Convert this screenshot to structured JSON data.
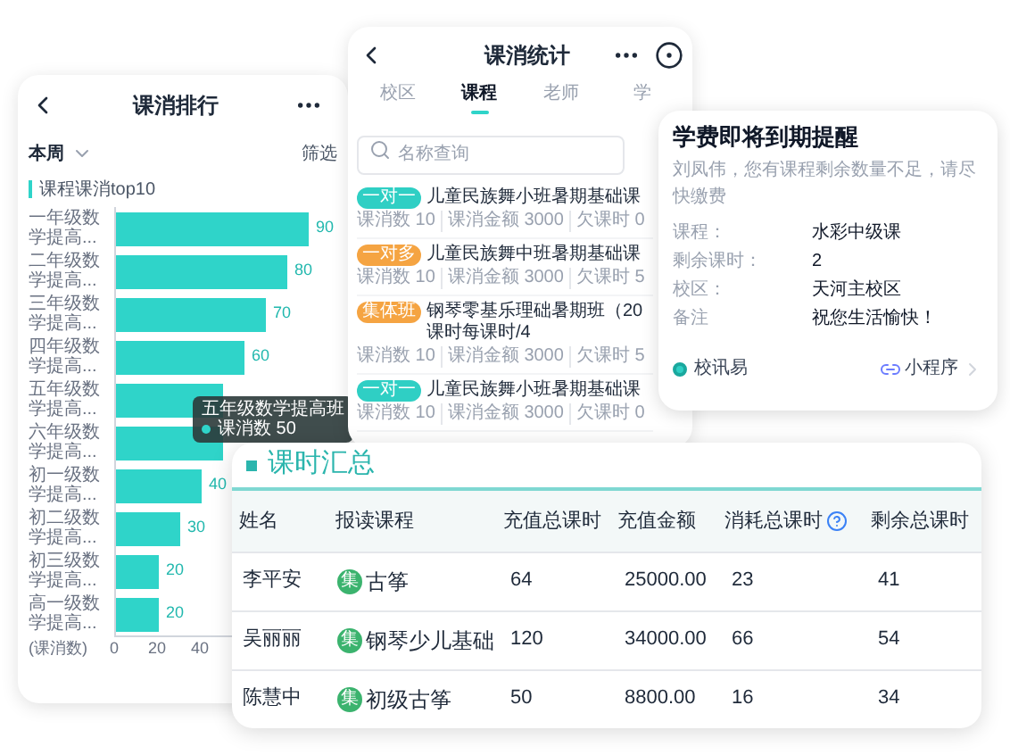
{
  "ranking_card": {
    "title": "课消排行",
    "period": "本周",
    "filter": "筛选",
    "section_title": "课程课消top10",
    "chart_data": {
      "type": "bar",
      "orientation": "horizontal",
      "xlabel": "(课消数)",
      "categories": [
        "一年级数学提高...",
        "二年级数学提高...",
        "三年级数学提高...",
        "四年级数学提高...",
        "五年级数学提高...",
        "六年级数学提高...",
        "初一级数学提高...",
        "初二级数学提高...",
        "初三级数学提高...",
        "高一级数学提高..."
      ],
      "series": [
        {
          "name": "课消数",
          "color": "#2fd4c9",
          "values": [
            90,
            80,
            70,
            60,
            50,
            50,
            40,
            30,
            20,
            20
          ]
        }
      ],
      "xlim": [
        0,
        100
      ],
      "xticks": [
        0,
        20,
        40
      ],
      "value_labels": [
        "90",
        "80",
        "70",
        "60",
        null,
        null,
        "40",
        "30",
        "20",
        "20"
      ]
    },
    "tooltip": {
      "title": "五年级数学提高班",
      "value": "50"
    }
  },
  "stats_card": {
    "title": "课消统计",
    "tabs": [
      {
        "label": "校区",
        "selected": false
      },
      {
        "label": "课程",
        "selected": true
      },
      {
        "label": "老师",
        "selected": false
      },
      {
        "label": "学",
        "selected": false
      }
    ],
    "search": {
      "placeholder": "名称查询"
    },
    "courses": [
      {
        "badge": "一对一",
        "color": "#2fcfc4",
        "name": "儿童民族舞小班暑期基础课",
        "stats": [
          {
            "label": "课消数",
            "value": "10"
          },
          {
            "label": "课消金额",
            "value": "3000"
          },
          {
            "label": "欠课时",
            "value": "0"
          }
        ]
      },
      {
        "badge": "一对多",
        "color": "#f5a442",
        "name": "儿童民族舞中班暑期基础课",
        "stats": [
          {
            "label": "课消数",
            "value": "10"
          },
          {
            "label": "课消金额",
            "value": "3000"
          },
          {
            "label": "欠课时",
            "value": "5"
          }
        ]
      },
      {
        "badge": "集体班",
        "color": "#f5a442",
        "name": "钢琴零基乐理础暑期班（20课时每课时/4",
        "stats": [
          {
            "label": "课消数",
            "value": "10"
          },
          {
            "label": "课消金额",
            "value": "3000"
          },
          {
            "label": "欠课时",
            "value": "5"
          }
        ]
      },
      {
        "badge": "一对一",
        "color": "#2fcfc4",
        "name": "儿童民族舞小班暑期基础课",
        "stats": [
          {
            "label": "课消数",
            "value": "10"
          },
          {
            "label": "课消金额",
            "value": "3000"
          },
          {
            "label": "欠课时",
            "value": "0"
          }
        ]
      }
    ]
  },
  "reminder_card": {
    "title": "学费即将到期提醒",
    "message": "刘凤伟，您有课程剩余数量不足，请尽快缴费",
    "fields": [
      {
        "label": "课程：",
        "value": "水彩中级课"
      },
      {
        "label": "剩余课时：",
        "value": "2"
      },
      {
        "label": "校区：",
        "value": "天河主校区"
      },
      {
        "label": "备注",
        "value": "祝您生活愉快！"
      }
    ],
    "source": "校讯易",
    "link": "小程序"
  },
  "summary_table": {
    "title": "课时汇总",
    "columns": [
      {
        "label": "姓名"
      },
      {
        "label": "报读课程"
      },
      {
        "label": "充值总课时"
      },
      {
        "label": "充值金额"
      },
      {
        "label": "消耗总课时",
        "help": true
      },
      {
        "label": "剩余总课时"
      }
    ],
    "rows": [
      {
        "name": "李平安",
        "course": {
          "badge": "集",
          "text": "古筝"
        },
        "values": [
          "64",
          "25000.00",
          "23",
          "41"
        ]
      },
      {
        "name": "吴丽丽",
        "course": {
          "badge": "集",
          "text": "钢琴少儿基础"
        },
        "values": [
          "120",
          "34000.00",
          "66",
          "54"
        ]
      },
      {
        "name": "陈慧中",
        "course": {
          "badge": "集",
          "text": "初级古筝"
        },
        "values": [
          "50",
          "8800.00",
          "16",
          "34"
        ]
      }
    ]
  }
}
